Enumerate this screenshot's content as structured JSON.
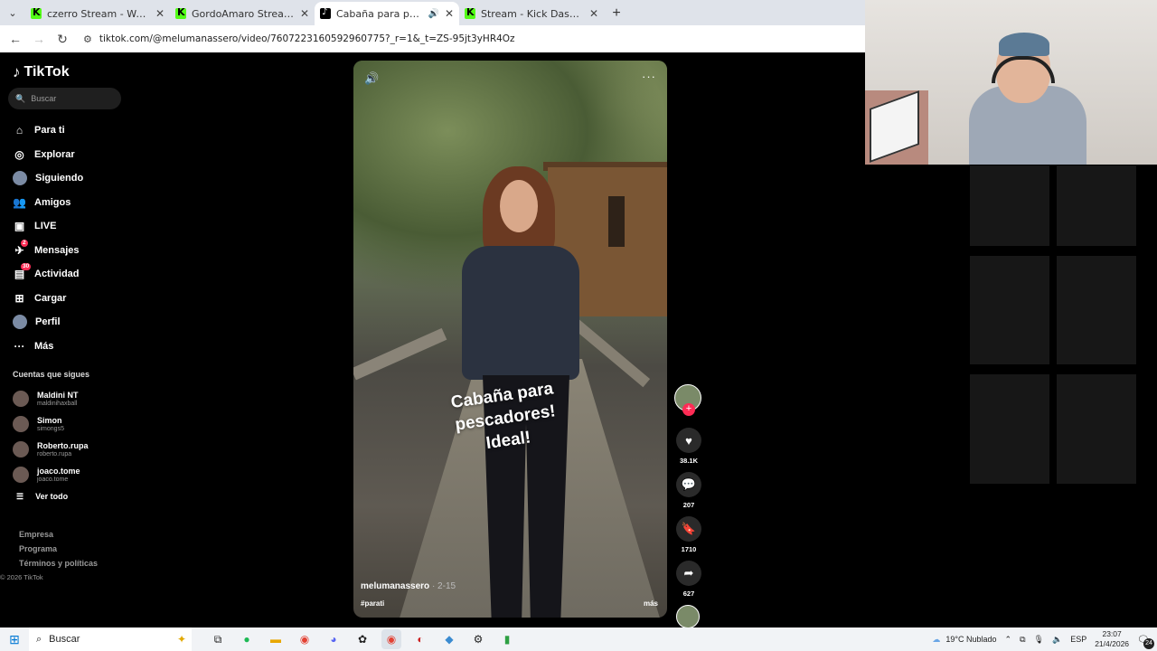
{
  "browser": {
    "tabs": [
      {
        "title": "czerro Stream - Watch Live on K",
        "favicon": "kick",
        "active": false
      },
      {
        "title": "GordoAmaro Stream - Watch Li",
        "favicon": "kick",
        "active": false
      },
      {
        "title": "Cabaña para pescadores en",
        "favicon": "tiktok",
        "active": true,
        "playing_audio": true
      },
      {
        "title": "Stream - Kick Dashboard",
        "favicon": "kick",
        "active": false
      }
    ],
    "url": "tiktok.com/@melumanassero/video/7607223160592960775?_r=1&_t=ZS-95jt3yHR4Oz"
  },
  "tiktok": {
    "logo": "TikTok",
    "search_placeholder": "Buscar",
    "menu": [
      {
        "label": "Para ti",
        "icon": "home-icon"
      },
      {
        "label": "Explorar",
        "icon": "compass-icon"
      },
      {
        "label": "Siguiendo",
        "icon": "following-avatar"
      },
      {
        "label": "Amigos",
        "icon": "friends-icon"
      },
      {
        "label": "LIVE",
        "icon": "live-icon"
      },
      {
        "label": "Mensajes",
        "icon": "messages-icon",
        "badge": "2"
      },
      {
        "label": "Actividad",
        "icon": "activity-icon",
        "badge": "30"
      },
      {
        "label": "Cargar",
        "icon": "upload-icon"
      },
      {
        "label": "Perfil",
        "icon": "profile-avatar"
      },
      {
        "label": "Más",
        "icon": "more-icon"
      }
    ],
    "following_header": "Cuentas que sigues",
    "following": [
      {
        "name": "Maldini NT",
        "handle": "maldinihaxball"
      },
      {
        "name": "Simon",
        "handle": "simongs5"
      },
      {
        "name": "Roberto.rupa",
        "handle": "roberto.rupa"
      },
      {
        "name": "joaco.tome",
        "handle": "joaco.tome"
      }
    ],
    "see_all": "Ver todo",
    "footer_links": [
      "Empresa",
      "Programa",
      "Términos y políticas"
    ],
    "copyright": "© 2026 TikTok"
  },
  "video": {
    "overlay_text": [
      "Cabaña para",
      "pescadores!",
      "Ideal!"
    ],
    "author": "melumanassero",
    "time_ago": "· 2-15",
    "hashtag": "#parati",
    "more_label": "más",
    "likes": "38.1K",
    "comments": "207",
    "saves": "1710",
    "shares": "627"
  },
  "taskbar": {
    "search_label": "Buscar",
    "weather": "19°C  Nublado",
    "language": "ESP",
    "time": "23:07",
    "date": "21/4/2026",
    "notifications": "24"
  },
  "colors": {
    "accent": "#fe2c55",
    "kick_green": "#53fc18",
    "background": "#000000"
  }
}
